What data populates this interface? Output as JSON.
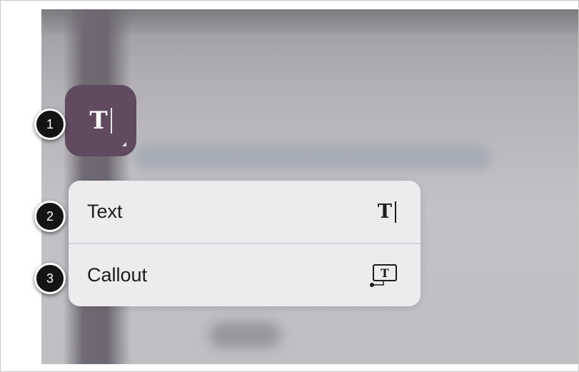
{
  "toolbar": {
    "text_tool_icon": "text-cursor-icon"
  },
  "menu": {
    "items": [
      {
        "label": "Text",
        "icon": "text-cursor-icon"
      },
      {
        "label": "Callout",
        "icon": "callout-icon"
      }
    ]
  },
  "callouts": [
    "1",
    "2",
    "3"
  ],
  "colors": {
    "tool_button": "#5f4a5f",
    "menu_background": "#ecebed",
    "badge": "#141414"
  }
}
